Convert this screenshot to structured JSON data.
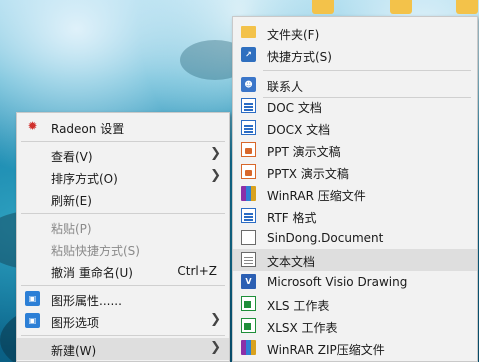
{
  "left_menu": {
    "header": "Radeon 设置",
    "items": [
      {
        "label": "查看(V)",
        "submenu": true
      },
      {
        "label": "排序方式(O)",
        "submenu": true
      },
      {
        "label": "刷新(E)"
      },
      {
        "label": "粘贴(P)",
        "disabled": true
      },
      {
        "label": "粘贴快捷方式(S)",
        "disabled": true
      },
      {
        "label": "撤消 重命名(U)",
        "shortcut": "Ctrl+Z"
      },
      {
        "label": "图形属性......"
      },
      {
        "label": "图形选项",
        "submenu": true
      },
      {
        "label": "新建(W)",
        "submenu": true,
        "highlighted": true
      }
    ]
  },
  "new_submenu": {
    "items": [
      {
        "label": "文件夹(F)",
        "icon": "folder-icon"
      },
      {
        "label": "快捷方式(S)",
        "icon": "shortcut-icon"
      },
      {
        "label": "联系人",
        "icon": "contact-icon"
      },
      {
        "label": "DOC 文档",
        "icon": "doc-file-icon"
      },
      {
        "label": "DOCX 文档",
        "icon": "docx-file-icon"
      },
      {
        "label": "PPT 演示文稿",
        "icon": "ppt-file-icon"
      },
      {
        "label": "PPTX 演示文稿",
        "icon": "pptx-file-icon"
      },
      {
        "label": "WinRAR 压缩文件",
        "icon": "winrar-archive-icon"
      },
      {
        "label": "RTF 格式",
        "icon": "rtf-file-icon"
      },
      {
        "label": "SinDong.Document",
        "icon": "blank-document-icon"
      },
      {
        "label": "文本文档",
        "icon": "text-document-icon",
        "highlighted": true
      },
      {
        "label": "Microsoft Visio Drawing",
        "icon": "visio-drawing-icon"
      },
      {
        "label": "XLS 工作表",
        "icon": "xls-file-icon"
      },
      {
        "label": "XLSX 工作表",
        "icon": "xlsx-file-icon"
      },
      {
        "label": "WinRAR ZIP压缩文件",
        "icon": "winrar-zip-icon"
      }
    ]
  },
  "colors": {
    "menu_bg": "#f2f2f2",
    "highlight": "#dedede",
    "separator": "#d0d0d0",
    "radeon_red": "#d0312d"
  }
}
